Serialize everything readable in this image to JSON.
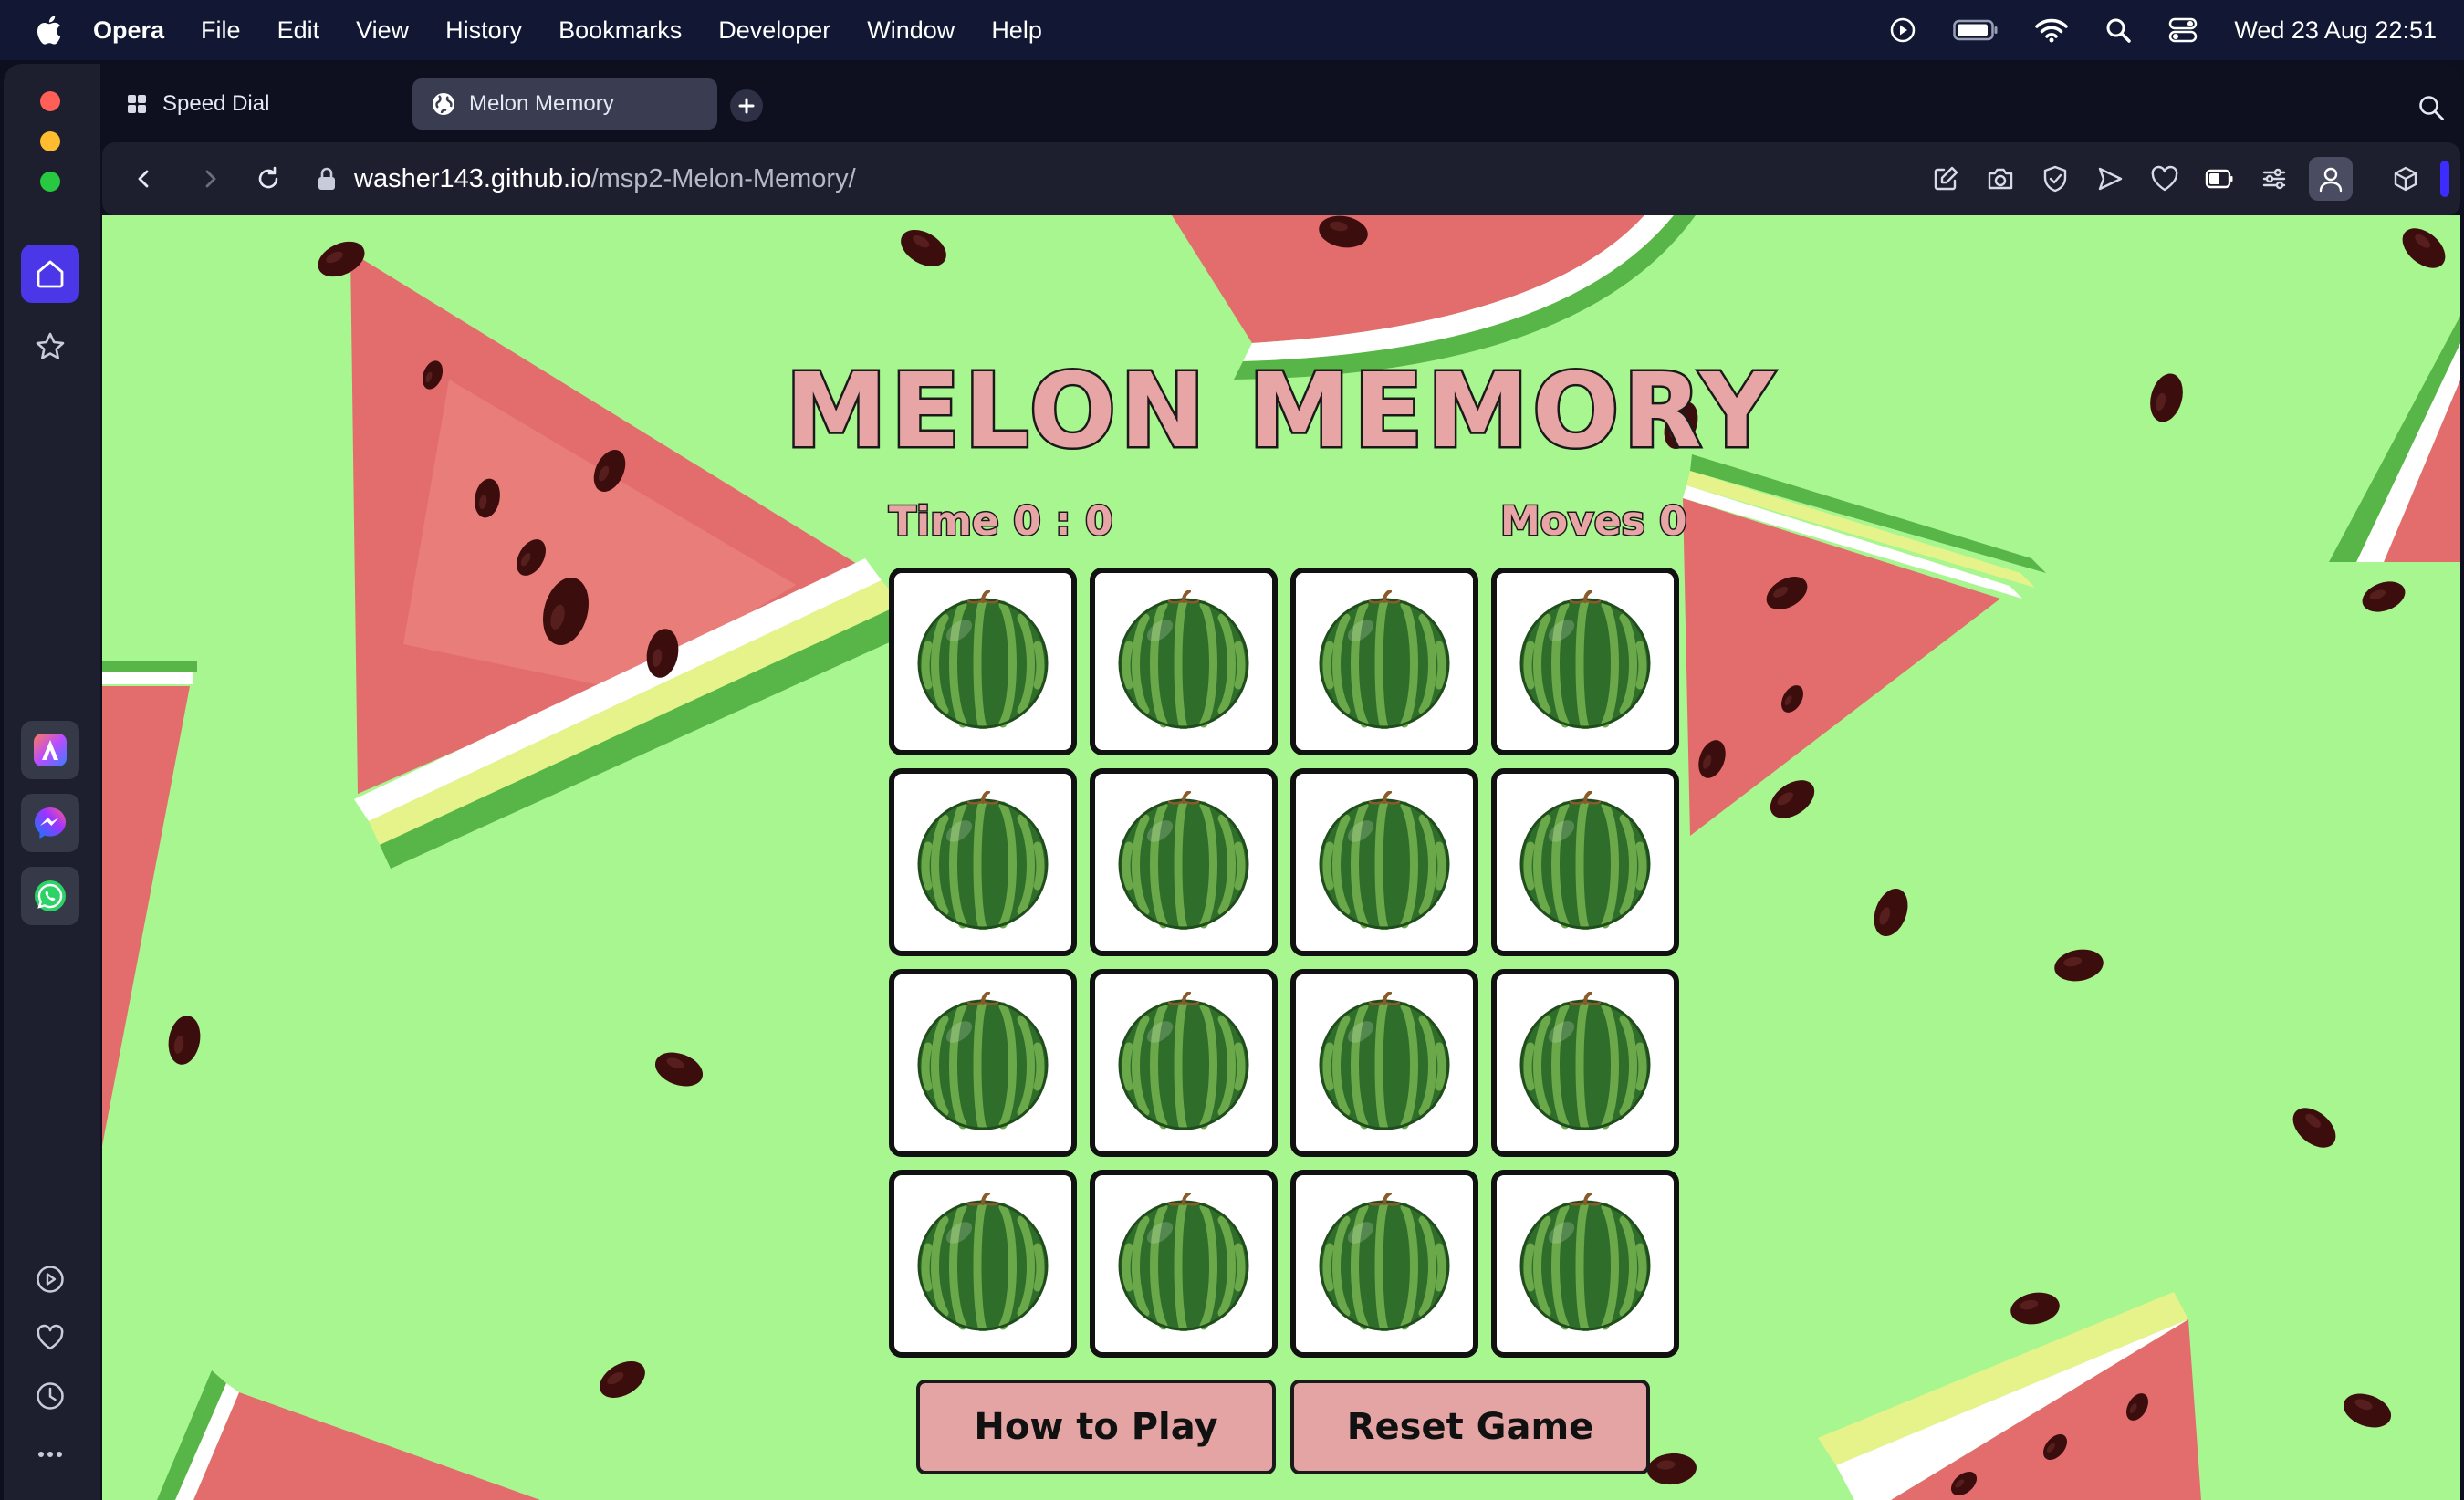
{
  "menubar": {
    "app_name": "Opera",
    "items": [
      "File",
      "Edit",
      "View",
      "History",
      "Bookmarks",
      "Developer",
      "Window",
      "Help"
    ],
    "clock": "Wed 23 Aug  22:51"
  },
  "tabs": [
    {
      "label": "Speed Dial",
      "icon": "grid-icon",
      "active": false
    },
    {
      "label": "Melon Memory",
      "icon": "globe-icon",
      "active": true
    }
  ],
  "address": {
    "host": "washer143.github.io",
    "path": "/msp2-Melon-Memory/"
  },
  "game": {
    "title": "MELON MEMORY",
    "time_label": "Time 0 : 0",
    "moves_label": "Moves 0",
    "card_rows": 4,
    "card_cols": 4,
    "card_face": "watermelon-icon",
    "buttons": {
      "how_to_play": "How to Play",
      "reset": "Reset Game"
    }
  },
  "colors": {
    "page_background": "#a8f690",
    "title_fill": "#e7a6a5",
    "button_fill": "#e4a4a3",
    "sidebar_active": "#4b37e8"
  }
}
